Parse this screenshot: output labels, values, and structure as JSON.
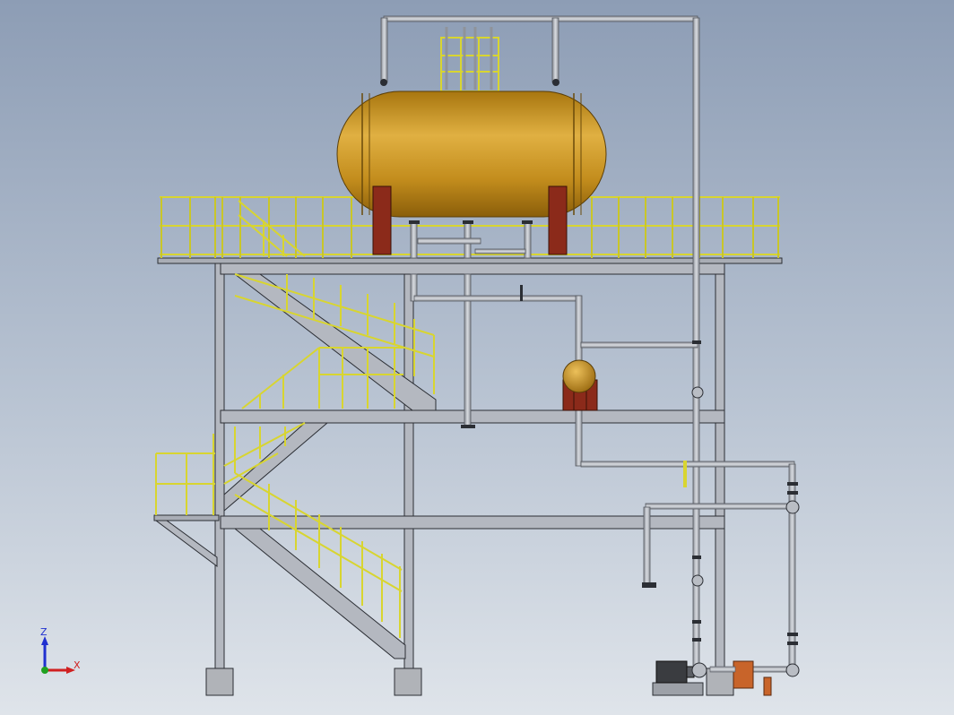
{
  "viewport": {
    "background_top": "#8d9db5",
    "background_bottom": "#dfe4ea"
  },
  "colors": {
    "tank": "#c8921e",
    "tank_highlight": "#e3b448",
    "tank_support": "#8b2a1a",
    "railing": "#e2df3a",
    "steel": "#b4b8c0",
    "steel_edge": "#2b2e34",
    "pipe": "#b9bdc4",
    "motor": "#3a3c40",
    "pump_heater": "#c8642a"
  },
  "scene": {
    "main_tank": "horizontal-storage-tank",
    "small_vessel": "spherical-vessel",
    "pump_skid": "motor-pump-unit",
    "structure": "three-level-steel-platform-with-stairs"
  },
  "triad": {
    "z_label": "Z",
    "x_label": "X",
    "z_color": "#2030d0",
    "x_color": "#d02020",
    "y_color": "#20a020"
  }
}
